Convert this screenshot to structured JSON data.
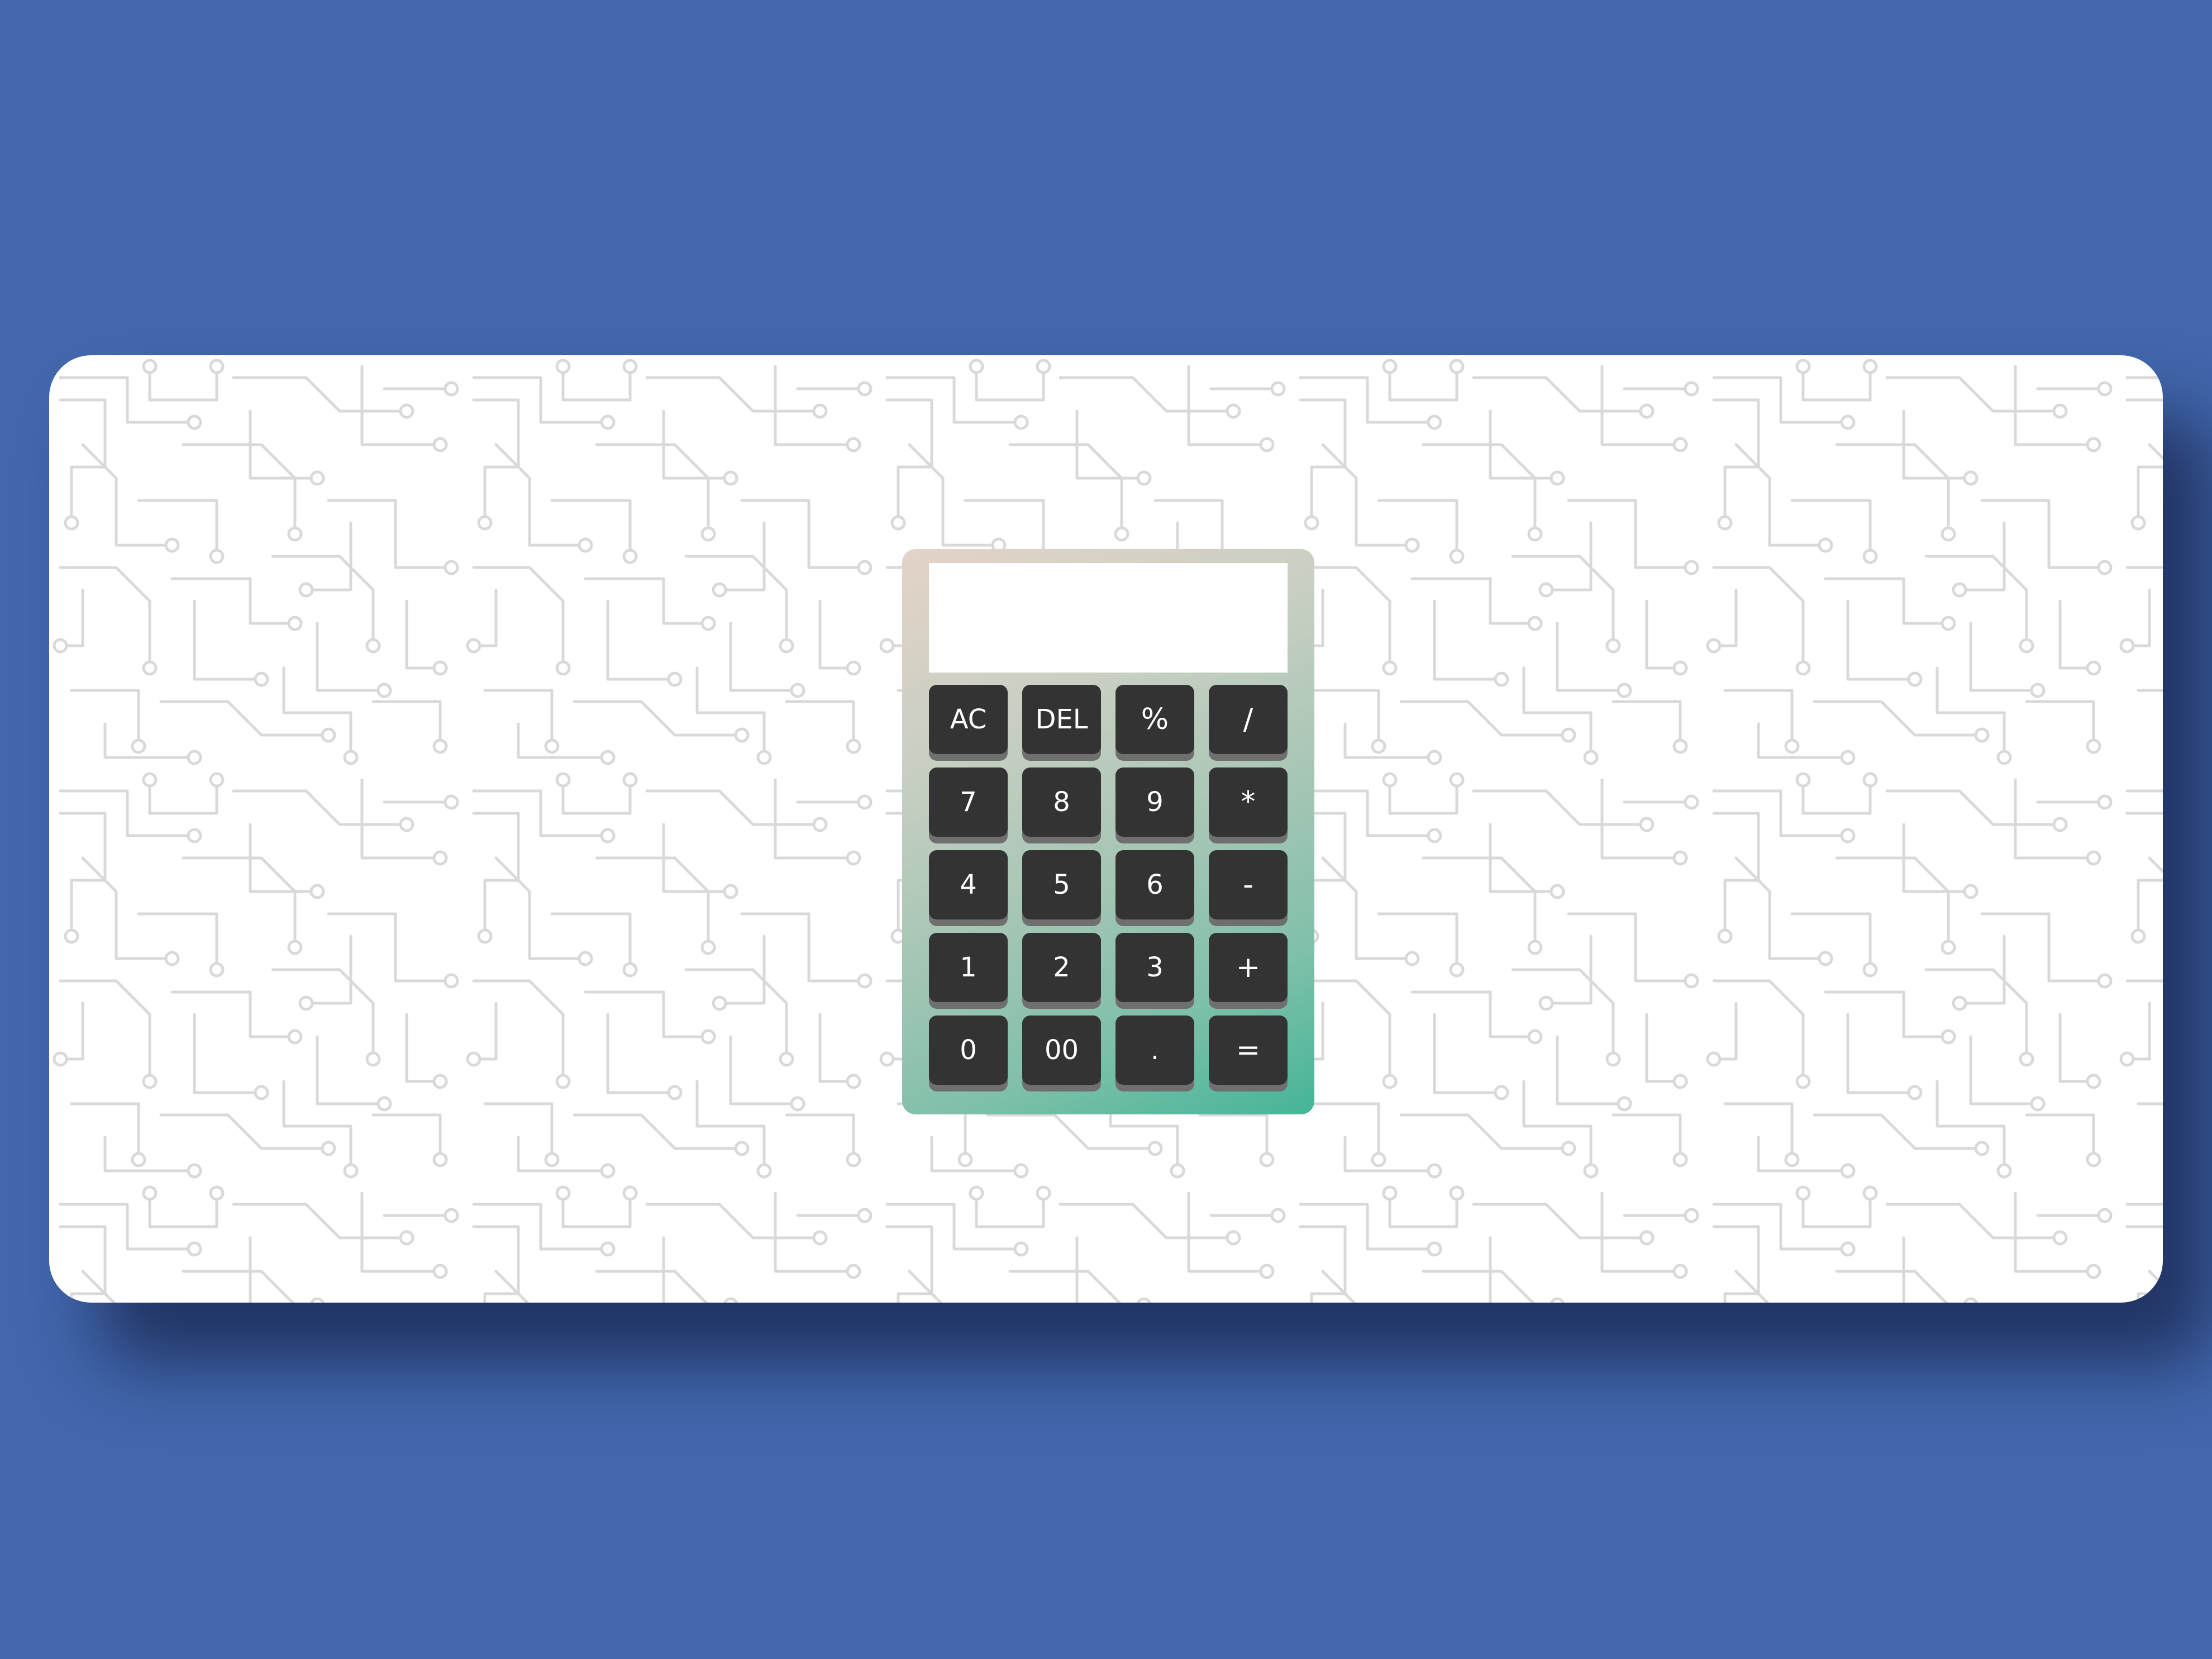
{
  "page": {
    "background_color": "#4267ad",
    "window_background": "#ffffff",
    "pattern": "circuit-board-icon"
  },
  "calculator": {
    "display_value": "",
    "gradient_colors": [
      "#e4d3c8",
      "#44b597"
    ],
    "key_color": "#333333",
    "keys": [
      {
        "label": "AC",
        "role": "clear"
      },
      {
        "label": "DEL",
        "role": "delete"
      },
      {
        "label": "%",
        "role": "operator"
      },
      {
        "label": "/",
        "role": "operator"
      },
      {
        "label": "7",
        "role": "digit"
      },
      {
        "label": "8",
        "role": "digit"
      },
      {
        "label": "9",
        "role": "digit"
      },
      {
        "label": "*",
        "role": "operator"
      },
      {
        "label": "4",
        "role": "digit"
      },
      {
        "label": "5",
        "role": "digit"
      },
      {
        "label": "6",
        "role": "digit"
      },
      {
        "label": "-",
        "role": "operator"
      },
      {
        "label": "1",
        "role": "digit"
      },
      {
        "label": "2",
        "role": "digit"
      },
      {
        "label": "3",
        "role": "digit"
      },
      {
        "label": "+",
        "role": "operator"
      },
      {
        "label": "0",
        "role": "digit"
      },
      {
        "label": "00",
        "role": "digit"
      },
      {
        "label": ".",
        "role": "decimal"
      },
      {
        "label": "=",
        "role": "equals"
      }
    ]
  }
}
